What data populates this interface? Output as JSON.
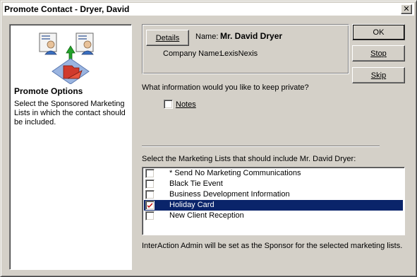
{
  "window": {
    "title": "Promote Contact - Dryer, David",
    "close_symbol": "✕"
  },
  "left_panel": {
    "heading": "Promote Options",
    "description": "Select the Sponsored Marketing Lists in which the contact should be included."
  },
  "contact": {
    "details_button": "Details",
    "name_label": "Name:",
    "name_value": "Mr. David Dryer",
    "company_label": "Company Name:",
    "company_value": "LexisNexis"
  },
  "buttons": {
    "ok": "OK",
    "stop": "Stop",
    "skip": "Skip"
  },
  "privacy": {
    "question": "What information would you like to keep private?",
    "notes_label": "Notes",
    "notes_checked": false
  },
  "marketing": {
    "prompt": "Select the Marketing Lists that should include Mr. David Dryer:",
    "items": [
      {
        "label": "* Send No Marketing Communications",
        "checked": false,
        "selected": false
      },
      {
        "label": "Black Tie Event",
        "checked": false,
        "selected": false
      },
      {
        "label": "Business Development Information",
        "checked": false,
        "selected": false
      },
      {
        "label": "Holiday Card",
        "checked": true,
        "selected": true
      },
      {
        "label": "New Client Reception",
        "checked": false,
        "selected": false
      }
    ],
    "check_color": "#c00000",
    "selection_color": "#0a246a"
  },
  "footer": "InterAction Admin will be set as the Sponsor for the selected marketing lists."
}
